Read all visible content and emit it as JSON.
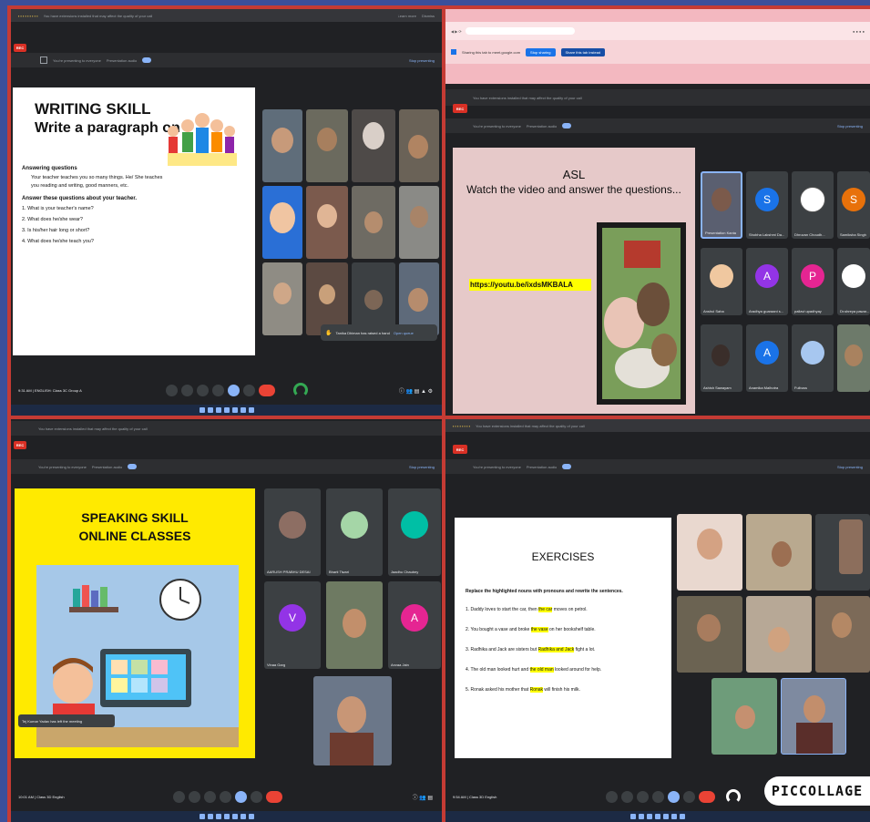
{
  "q1": {
    "meet_top": "You have extensions installed that may affect the quality of your call",
    "presenting": "You're presenting to everyone",
    "presentation_audio": "Presentation audio",
    "stop_presenting": "Stop presenting",
    "learn_more": "Learn more",
    "dismiss": "Dismiss",
    "slide": {
      "title": "WRITING SKILL",
      "subtitle": "Write a paragraph on",
      "section1": "Answering questions",
      "item1": "Your teacher teaches you so many things. He/ She teaches you reading and writing, good manners, etc.",
      "section2": "Answer these questions about your teacher.",
      "questions": [
        "1. What is your teacher's name?",
        "2. What does he/she wear?",
        "3. Is his/her hair long or short?",
        "4. What does he/she teach you?"
      ]
    },
    "tiles": [
      "",
      "",
      "",
      "",
      "",
      "",
      "",
      "",
      "",
      "",
      "",
      ""
    ],
    "toast": "Tanika Dhiman has raised a hand",
    "toast_action": "Open queue",
    "meeting_info": "9:31 AM | ENGLISH: Class 3C Group A"
  },
  "q2": {
    "banner_text": "Sharing this tab to meet.google.com",
    "banner_btn1": "Stop sharing",
    "banner_btn2": "Share this tab instead",
    "meet_top": "You have extensions installed that may affect the quality of your call",
    "presenting": "You're presenting to everyone",
    "presentation_audio": "Presentation audio",
    "stop_presenting": "Stop presenting",
    "slide": {
      "title": "ASL",
      "subtitle": "Watch the video and answer the questions...",
      "link": "https://youtu.be/ixdsMKBALA"
    },
    "tiles": [
      {
        "name": "Presentation Kanta",
        "initial": "",
        "color": "#3c4043"
      },
      {
        "name": "Shobha Lakshmi Da...",
        "initial": "S",
        "color": "#1a73e8"
      },
      {
        "name": "Dhruvan Choudh...",
        "initial": "",
        "color": "#3c4043"
      },
      {
        "name": "Samiksha Singh",
        "initial": "S",
        "color": "#e8710a"
      },
      {
        "name": "Anshul Saha",
        "initial": "",
        "color": "#3c4043"
      },
      {
        "name": "Aradhya guaraani s...",
        "initial": "A",
        "color": "#9334e6"
      },
      {
        "name": "pallavi upadhyay",
        "initial": "P",
        "color": "#e52592"
      },
      {
        "name": "Dr.shreya pawar...",
        "initial": "",
        "color": "#3c4043"
      },
      {
        "name": "Ashish Sawayam",
        "initial": "",
        "color": "#3c4043"
      },
      {
        "name": "Anamika Malhotra",
        "initial": "A",
        "color": "#1a73e8"
      },
      {
        "name": "Fulbuss",
        "initial": "",
        "color": "#3c4043"
      },
      {
        "name": "",
        "initial": "",
        "color": "#3c4043"
      }
    ]
  },
  "q3": {
    "meet_top": "You have extensions installed that may affect the quality of your call",
    "presenting": "You're presenting to everyone",
    "presentation_audio": "Presentation audio",
    "stop_presenting": "Stop presenting",
    "slide": {
      "title1": "SPEAKING SKILL",
      "title2": "ONLINE CLASSES"
    },
    "tiles": [
      {
        "name": "AARUSH PRABHU DESAI",
        "initial": "",
        "color": "#3c4043"
      },
      {
        "name": "Bharti Tiwari",
        "initial": "",
        "color": "#3c4043"
      },
      {
        "name": "Jaadhu Chaubey",
        "initial": "",
        "color": "#3c4043"
      },
      {
        "name": "Vinaa Garg",
        "initial": "V",
        "color": "#9334e6"
      },
      {
        "name": "",
        "initial": "",
        "color": "#3c4043"
      },
      {
        "name": "Anvaa Jain",
        "initial": "A",
        "color": "#e52592"
      }
    ],
    "toast": "Tej Kumar Yadav has left the meeting",
    "meeting_info": "10:01 AM | Class 3D English"
  },
  "q4": {
    "meet_top": "You have extensions installed that may affect the quality of your call",
    "presenting": "You're presenting to everyone",
    "presentation_audio": "Presentation audio",
    "stop_presenting": "Stop presenting",
    "slide": {
      "title": "EXERCISES",
      "instruction": "Replace the highlighted nouns with pronouns and rewrite the sentences.",
      "sentences": [
        {
          "pre": "1. Daddy loves to start the car, then ",
          "hl": "the car",
          "post": " moves on petrol."
        },
        {
          "pre": "2. You bought a vase and broke ",
          "hl": "the vase",
          "post": " on her bookshelf table."
        },
        {
          "pre": "3. Radhika and Jack are sisters but ",
          "hl": "Radhika and Jack",
          "post": " fight a lot."
        },
        {
          "pre": "4. The old man looked hurt and ",
          "hl": "the old man",
          "post": " looked around for help."
        },
        {
          "pre": "5. Ronak asked his mother that ",
          "hl": "Ronak",
          "post": " will finish his milk."
        }
      ]
    },
    "tiles": [
      "",
      "",
      "",
      "",
      "",
      "",
      "",
      ""
    ],
    "meeting_info": "9:54 AM | Class 3D English",
    "brand": "PICCOLLAGE"
  }
}
